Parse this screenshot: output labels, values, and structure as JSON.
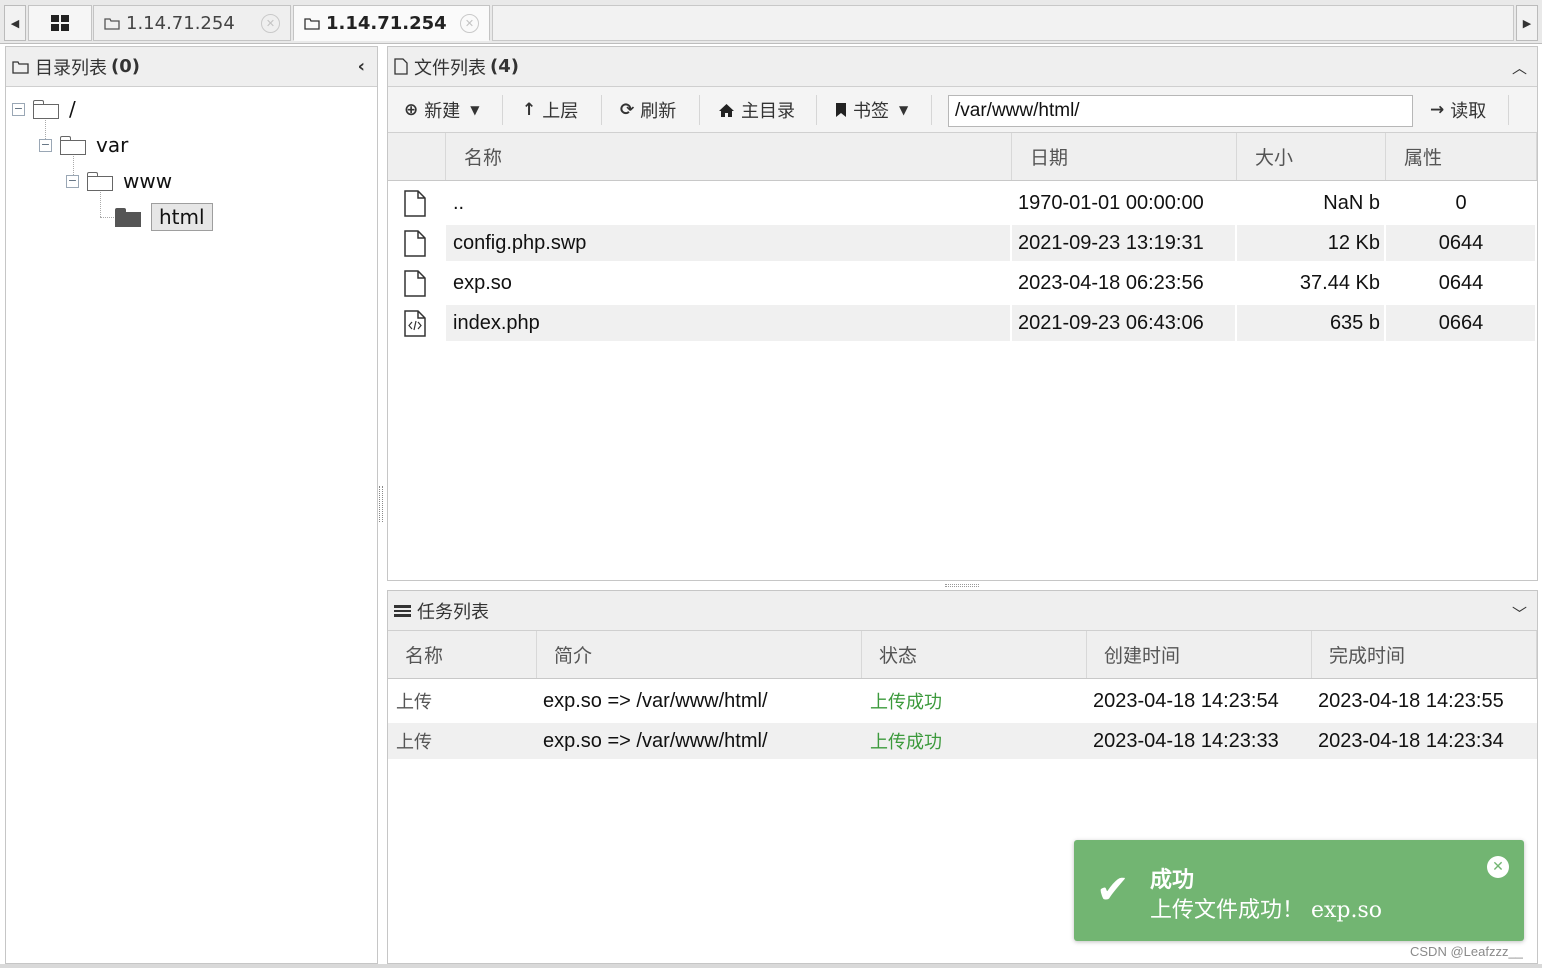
{
  "tabs": [
    {
      "label": "1.14.71.254",
      "active": false
    },
    {
      "label": "1.14.71.254",
      "active": true
    }
  ],
  "dir_panel": {
    "title": "目录列表",
    "count": "(0)",
    "tree": [
      {
        "label": "/"
      },
      {
        "label": "var"
      },
      {
        "label": "www"
      },
      {
        "label": "html",
        "selected": true
      }
    ]
  },
  "file_panel": {
    "title": "文件列表",
    "count": "(4)",
    "toolbar": {
      "new": "新建",
      "up": "上层",
      "refresh": "刷新",
      "home": "主目录",
      "bookmark": "书签",
      "path": "/var/www/html/",
      "read": "读取"
    },
    "columns": [
      "名称",
      "日期",
      "大小",
      "属性"
    ],
    "rows": [
      {
        "name": "..",
        "date": "1970-01-01 00:00:00",
        "size": "NaN b",
        "perm": "0",
        "icon": "file-icon"
      },
      {
        "name": "config.php.swp",
        "date": "2021-09-23 13:19:31",
        "size": "12 Kb",
        "perm": "0644",
        "icon": "file-icon"
      },
      {
        "name": "exp.so",
        "date": "2023-04-18 06:23:56",
        "size": "37.44 Kb",
        "perm": "0644",
        "icon": "file-icon"
      },
      {
        "name": "index.php",
        "date": "2021-09-23 06:43:06",
        "size": "635 b",
        "perm": "0664",
        "icon": "code-file-icon"
      }
    ]
  },
  "task_panel": {
    "title": "任务列表",
    "columns": [
      "名称",
      "简介",
      "状态",
      "创建时间",
      "完成时间"
    ],
    "rows": [
      {
        "name": "上传",
        "desc": "exp.so => /var/www/html/",
        "status": "上传成功",
        "created": "2023-04-18 14:23:54",
        "finished": "2023-04-18 14:23:55"
      },
      {
        "name": "上传",
        "desc": "exp.so => /var/www/html/",
        "status": "上传成功",
        "created": "2023-04-18 14:23:33",
        "finished": "2023-04-18 14:23:34"
      }
    ]
  },
  "toast": {
    "title": "成功",
    "message": "上传文件成功！ exp.so",
    "color": "#72b572"
  },
  "watermark": "CSDN @Leafzzz__",
  "colors": {
    "success_text": "#3c9a3c"
  }
}
